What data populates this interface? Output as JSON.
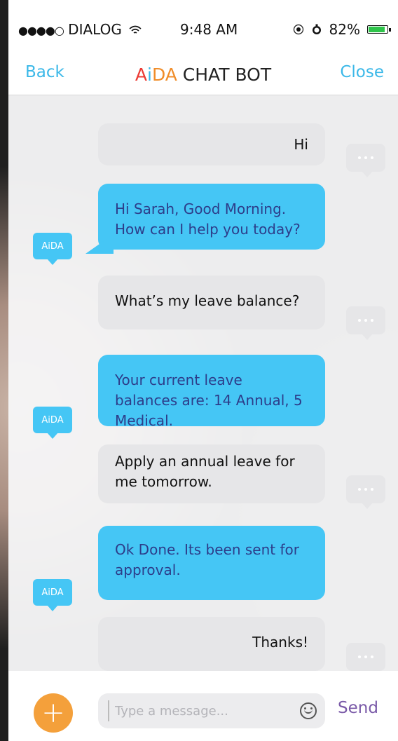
{
  "status_bar": {
    "signal": "●●●●○",
    "carrier": "DIALOG",
    "wifi_icon": "wifi-icon",
    "time": "9:48 AM",
    "battery": "82%",
    "battery_level": 0.82
  },
  "nav": {
    "back_label": "Back",
    "title_ai": "Ai",
    "title_i": "i",
    "title_da": "DA",
    "title_rest": " CHAT BOT",
    "close_label": "Close"
  },
  "messages": [
    {
      "from": "user",
      "text": "Hi"
    },
    {
      "from": "bot",
      "text": "Hi Sarah, Good Morning. How can I help you today?"
    },
    {
      "from": "user",
      "text": "What’s my leave balance?"
    },
    {
      "from": "bot",
      "text": "Your current leave balances are: 14 Annual, 5 Medical."
    },
    {
      "from": "user",
      "text": "Apply an annual leave for me tomorrow."
    },
    {
      "from": "bot",
      "text": "Ok Done. Its been sent for approval."
    },
    {
      "from": "user",
      "text": "Thanks!"
    }
  ],
  "bot_tag": "AiDA",
  "composer": {
    "plus_label": "+",
    "placeholder": "Type a message...",
    "send_label": "Send"
  },
  "colors": {
    "accent_blue": "#3bb8e8",
    "bot_bubble": "#45c6f5",
    "user_bubble": "#e6e6e8",
    "plus_orange": "#f4a03b",
    "send_purple": "#7a5aa8",
    "title_red": "#ec3b34",
    "title_orange": "#f08d2a"
  }
}
